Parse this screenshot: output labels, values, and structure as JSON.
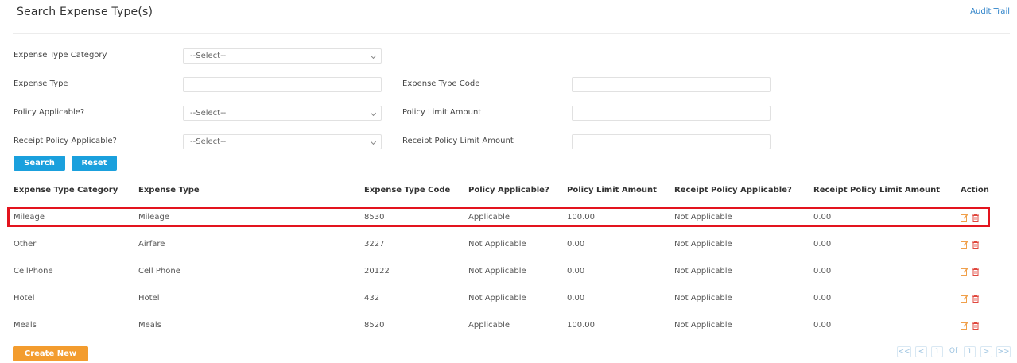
{
  "header": {
    "title": "Search Expense Type(s)",
    "audit_trail": "Audit Trail"
  },
  "form": {
    "category_label": "Expense Type Category",
    "category_value": "--Select--",
    "type_label": "Expense Type",
    "type_value": "",
    "code_label": "Expense Type Code",
    "code_value": "",
    "policy_label": "Policy Applicable?",
    "policy_value": "--Select--",
    "limit_label": "Policy Limit Amount",
    "limit_value": "",
    "receipt_label": "Receipt Policy Applicable?",
    "receipt_value": "--Select--",
    "receipt_limit_label": "Receipt Policy Limit Amount",
    "receipt_limit_value": "",
    "search_btn": "Search",
    "reset_btn": "Reset"
  },
  "table": {
    "headers": [
      "Expense Type Category",
      "Expense Type",
      "Expense Type Code",
      "Policy Applicable?",
      "Policy Limit Amount",
      "Receipt Policy Applicable?",
      "Receipt Policy Limit Amount",
      "Action"
    ],
    "rows": [
      [
        "Mileage",
        "Mileage",
        "8530",
        "Applicable",
        "100.00",
        "Not Applicable",
        "0.00"
      ],
      [
        "Other",
        "Airfare",
        "3227",
        "Not Applicable",
        "0.00",
        "Not Applicable",
        "0.00"
      ],
      [
        "CellPhone",
        "Cell Phone",
        "20122",
        "Not Applicable",
        "0.00",
        "Not Applicable",
        "0.00"
      ],
      [
        "Hotel",
        "Hotel",
        "432",
        "Not Applicable",
        "0.00",
        "Not Applicable",
        "0.00"
      ],
      [
        "Meals",
        "Meals",
        "8520",
        "Applicable",
        "100.00",
        "Not Applicable",
        "0.00"
      ]
    ],
    "highlighted_row": 0
  },
  "footer": {
    "create_new": "Create New",
    "pagination": {
      "first": "<<",
      "prev": "<",
      "page": "1",
      "of": "Of",
      "total": "1",
      "next": ">",
      "last": ">>"
    }
  },
  "colors": {
    "primary": "#1aa0dd",
    "accent": "#f39c2e",
    "highlight": "#e3141e",
    "edit_icon": "#f0a04b",
    "delete_icon": "#e0473e"
  }
}
